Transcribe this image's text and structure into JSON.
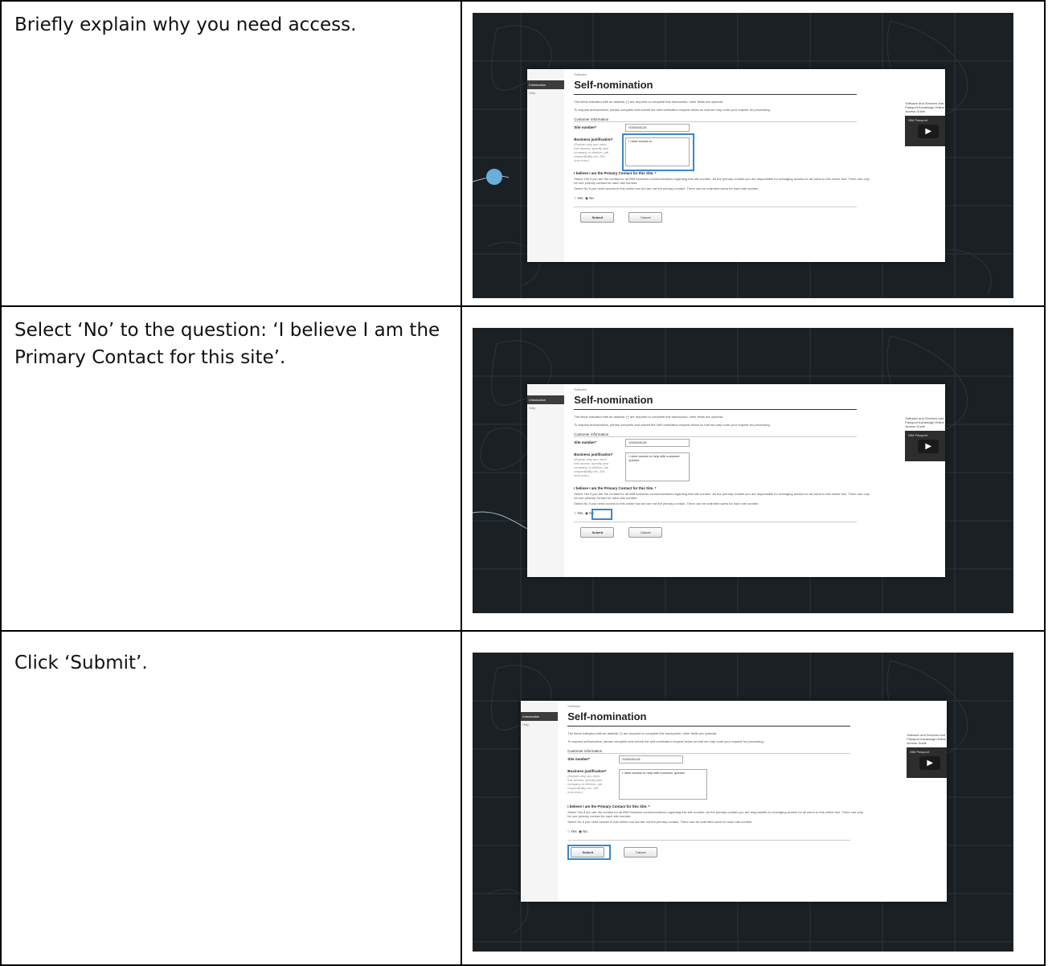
{
  "steps": [
    {
      "instruction": "Briefly explain why you need access.",
      "form": {
        "side_active": "Introduction",
        "side_help": "Help",
        "breadcrumb": "Software",
        "title": "Self-nomination",
        "note_required": "The fields indicated with an asterisk (*) are required to complete this transaction; other fields are optional.",
        "note_request": "To request authorization, please complete and submit the self-nomination request below so that we may route your request for processing.",
        "section": "Customer information",
        "site_label": "Site number*",
        "site_value": "0003046128",
        "justification_label": "Business justification*",
        "justification_hint": "(Explain why you need this access, specify your company or division, job responsibility etc. 250 char max.)",
        "justification_value": "I need access to",
        "question": "I believe I am the Primary Contact for this Site. *",
        "q_yes_text": "Select Yes if you are the contact for all IBM business communications regarding this site number. As the primary contact you are responsible for managing access for all users to this online tool. There can only be one primary contact for each site number.",
        "q_no_text": "Select No if you need access to this online tool but are not the primary contact. There can be unlimited users for each site number.",
        "radio_yes": "Yes",
        "radio_no": "No",
        "submit": "Submit",
        "cancel": "Cancel",
        "right_text": "Software and Services and Passport Advantage Online Access Guide",
        "video_text": "IBM Passport"
      }
    },
    {
      "instruction": "Select ‘No’ to the question: ‘I believe I am the Primary Contact for this site’.",
      "form": {
        "side_active": "Introduction",
        "side_help": "Help",
        "breadcrumb": "Software",
        "title": "Self-nomination",
        "note_required": "The fields indicated with an asterisk (*) are required to complete this transaction; other fields are optional.",
        "note_request": "To request authorization, please complete and submit the self-nomination request below so that we may route your request for processing.",
        "section": "Customer information",
        "site_label": "Site number*",
        "site_value": "0003046128",
        "justification_label": "Business justification*",
        "justification_hint": "(Explain why you need this access, specify your company or division, job responsibility etc. 250 char max.)",
        "justification_value": "I need access to help with customer queries",
        "question": "I believe I am the Primary Contact for this Site. *",
        "q_yes_text": "Select Yes if you are the contact for all IBM business communications regarding this site number. As the primary contact you are responsible for managing access for all users to this online tool. There can only be one primary contact for each site number.",
        "q_no_text": "Select No if you need access to this online tool but are not the primary contact. There can be unlimited users for each site number.",
        "radio_yes": "Yes",
        "radio_no": "No",
        "submit": "Submit",
        "cancel": "Cancel",
        "right_text": "Software and Services and Passport Advantage Online Access Guide",
        "video_text": "IBM Passport"
      }
    },
    {
      "instruction": "Click ‘Submit’.",
      "form": {
        "side_active": "Introduction",
        "side_help": "Help",
        "breadcrumb": "Software",
        "title": "Self-nomination",
        "note_required": "The fields indicated with an asterisk (*) are required to complete this transaction; other fields are optional.",
        "note_request": "To request authorization, please complete and submit the self-nomination request below so that we may route your request for processing.",
        "section": "Customer information",
        "site_label": "Site number*",
        "site_value": "0003046128",
        "justification_label": "Business justification*",
        "justification_hint": "(Explain why you need this access, specify your company or division, job responsibility etc. 250 char max.)",
        "justification_value": "I need access to help with customer queries",
        "question": "I believe I am the Primary Contact for this Site. *",
        "q_yes_text": "Select Yes if you are the contact for all IBM business communications regarding this site number. As the primary contact you are responsible for managing access for all users to this online tool. There can only be one primary contact for each site number.",
        "q_no_text": "Select No if you need access to this online tool but are not the primary contact. There can be unlimited users for each site number.",
        "radio_yes": "Yes",
        "radio_no": "No",
        "submit": "Submit",
        "cancel": "Cancel",
        "right_text": "Software and Services and Passport Advantage Online Access Guide",
        "video_text": "IBM Passport"
      }
    }
  ],
  "colors": {
    "highlight": "#3b86c8",
    "frame_bg": "#1b2024"
  }
}
